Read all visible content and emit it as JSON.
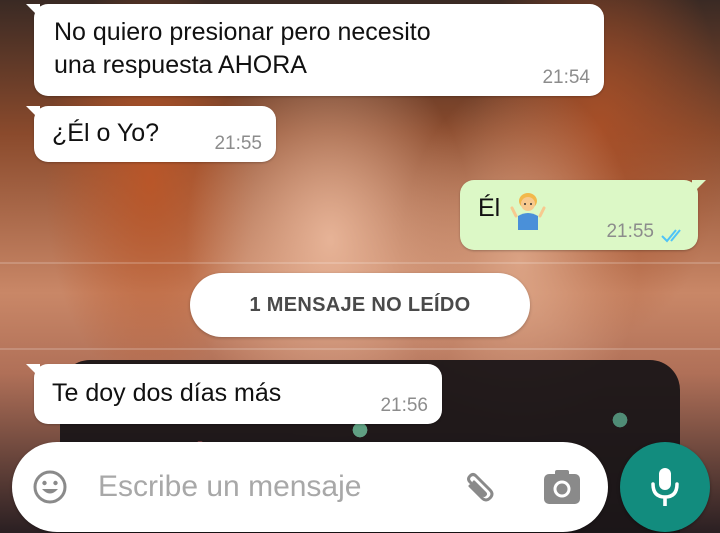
{
  "messages": [
    {
      "direction": "incoming",
      "text_line1": "No quiero presionar pero necesito",
      "text_line2": "una respuesta AHORA",
      "time": "21:54"
    },
    {
      "direction": "incoming",
      "text": "¿Él o Yo?",
      "time": "21:55"
    },
    {
      "direction": "outgoing",
      "text": "Él",
      "emoji": "person-shrugging-emoji",
      "time": "21:55",
      "status": "delivered-double-check"
    },
    {
      "direction": "incoming",
      "text": "Te doy dos días más",
      "time": "21:56"
    }
  ],
  "unread_banner": {
    "label": "1 MENSAJE NO LEÍDO"
  },
  "composer": {
    "placeholder": "Escribe un mensaje",
    "icons": [
      "emoji-icon",
      "attach-icon",
      "camera-icon"
    ],
    "send_icon": "mic-icon"
  },
  "colors": {
    "incoming_bubble": "#ffffff",
    "outgoing_bubble": "#dcf8c6",
    "accent": "#128c7e",
    "read_ticks": "#4fc3f7",
    "timestamp": "#8c8c8c"
  }
}
